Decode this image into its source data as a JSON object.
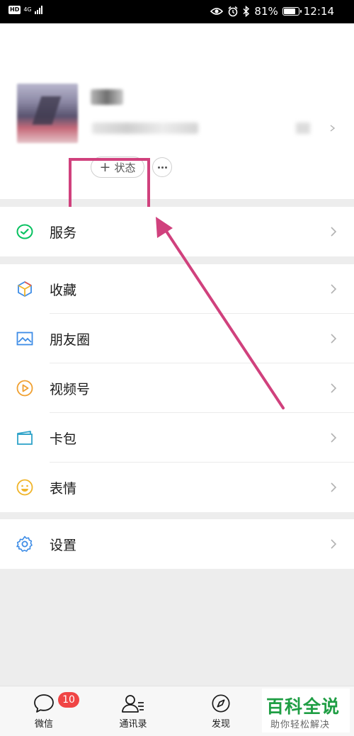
{
  "status_bar": {
    "network": "4G",
    "battery": "81%",
    "battery_level": 0.81,
    "time": "12:14"
  },
  "profile": {
    "status_button_label": "状态",
    "status_button_icon": "plus-icon",
    "more_icon": "more-dots-icon"
  },
  "annotation_color": "#d0417d",
  "menu": {
    "service": {
      "label": "服务",
      "icon": "service-icon"
    },
    "favorites": {
      "label": "收藏",
      "icon": "favorites-cube-icon"
    },
    "moments": {
      "label": "朋友圈",
      "icon": "moments-image-icon"
    },
    "channels": {
      "label": "视频号",
      "icon": "channels-play-icon"
    },
    "cards": {
      "label": "卡包",
      "icon": "card-wallet-icon"
    },
    "stickers": {
      "label": "表情",
      "icon": "smiley-icon"
    },
    "settings": {
      "label": "设置",
      "icon": "gear-icon"
    }
  },
  "tab_bar": {
    "chats": {
      "label": "微信",
      "badge": "10",
      "icon": "chat-bubble-icon"
    },
    "contacts": {
      "label": "通讯录",
      "icon": "contacts-icon"
    },
    "discover": {
      "label": "发现",
      "icon": "compass-icon"
    }
  },
  "watermark": {
    "title": "百科全说",
    "subtitle": "助你轻松解决"
  },
  "colors": {
    "wechat_green": "#07c160",
    "badge_red": "#f04545",
    "watermark_green": "#1f9e44"
  }
}
